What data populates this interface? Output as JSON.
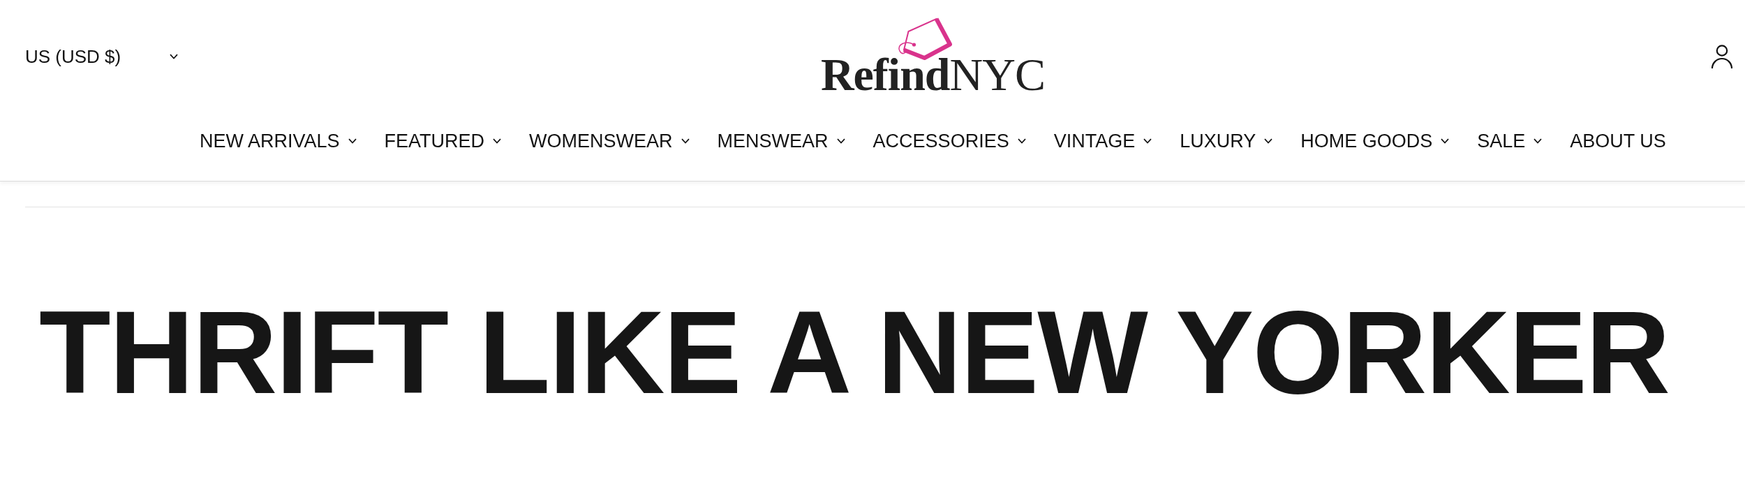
{
  "header": {
    "currency_selector": {
      "label": "US (USD $)"
    },
    "logo": {
      "text": "**Refind**NYC"
    },
    "nav": [
      {
        "label": "NEW ARRIVALS",
        "dropdown": true
      },
      {
        "label": "FEATURED",
        "dropdown": true
      },
      {
        "label": "WOMENSWEAR",
        "dropdown": true
      },
      {
        "label": "MENSWEAR",
        "dropdown": true
      },
      {
        "label": "ACCESSORIES",
        "dropdown": true
      },
      {
        "label": "VINTAGE",
        "dropdown": true
      },
      {
        "label": "LUXURY",
        "dropdown": true
      },
      {
        "label": "HOME GOODS",
        "dropdown": true
      },
      {
        "label": "SALE",
        "dropdown": true
      },
      {
        "label": "ABOUT US",
        "dropdown": false
      }
    ]
  },
  "hero": {
    "heading": "THRIFT LIKE A NEW YORKER"
  }
}
